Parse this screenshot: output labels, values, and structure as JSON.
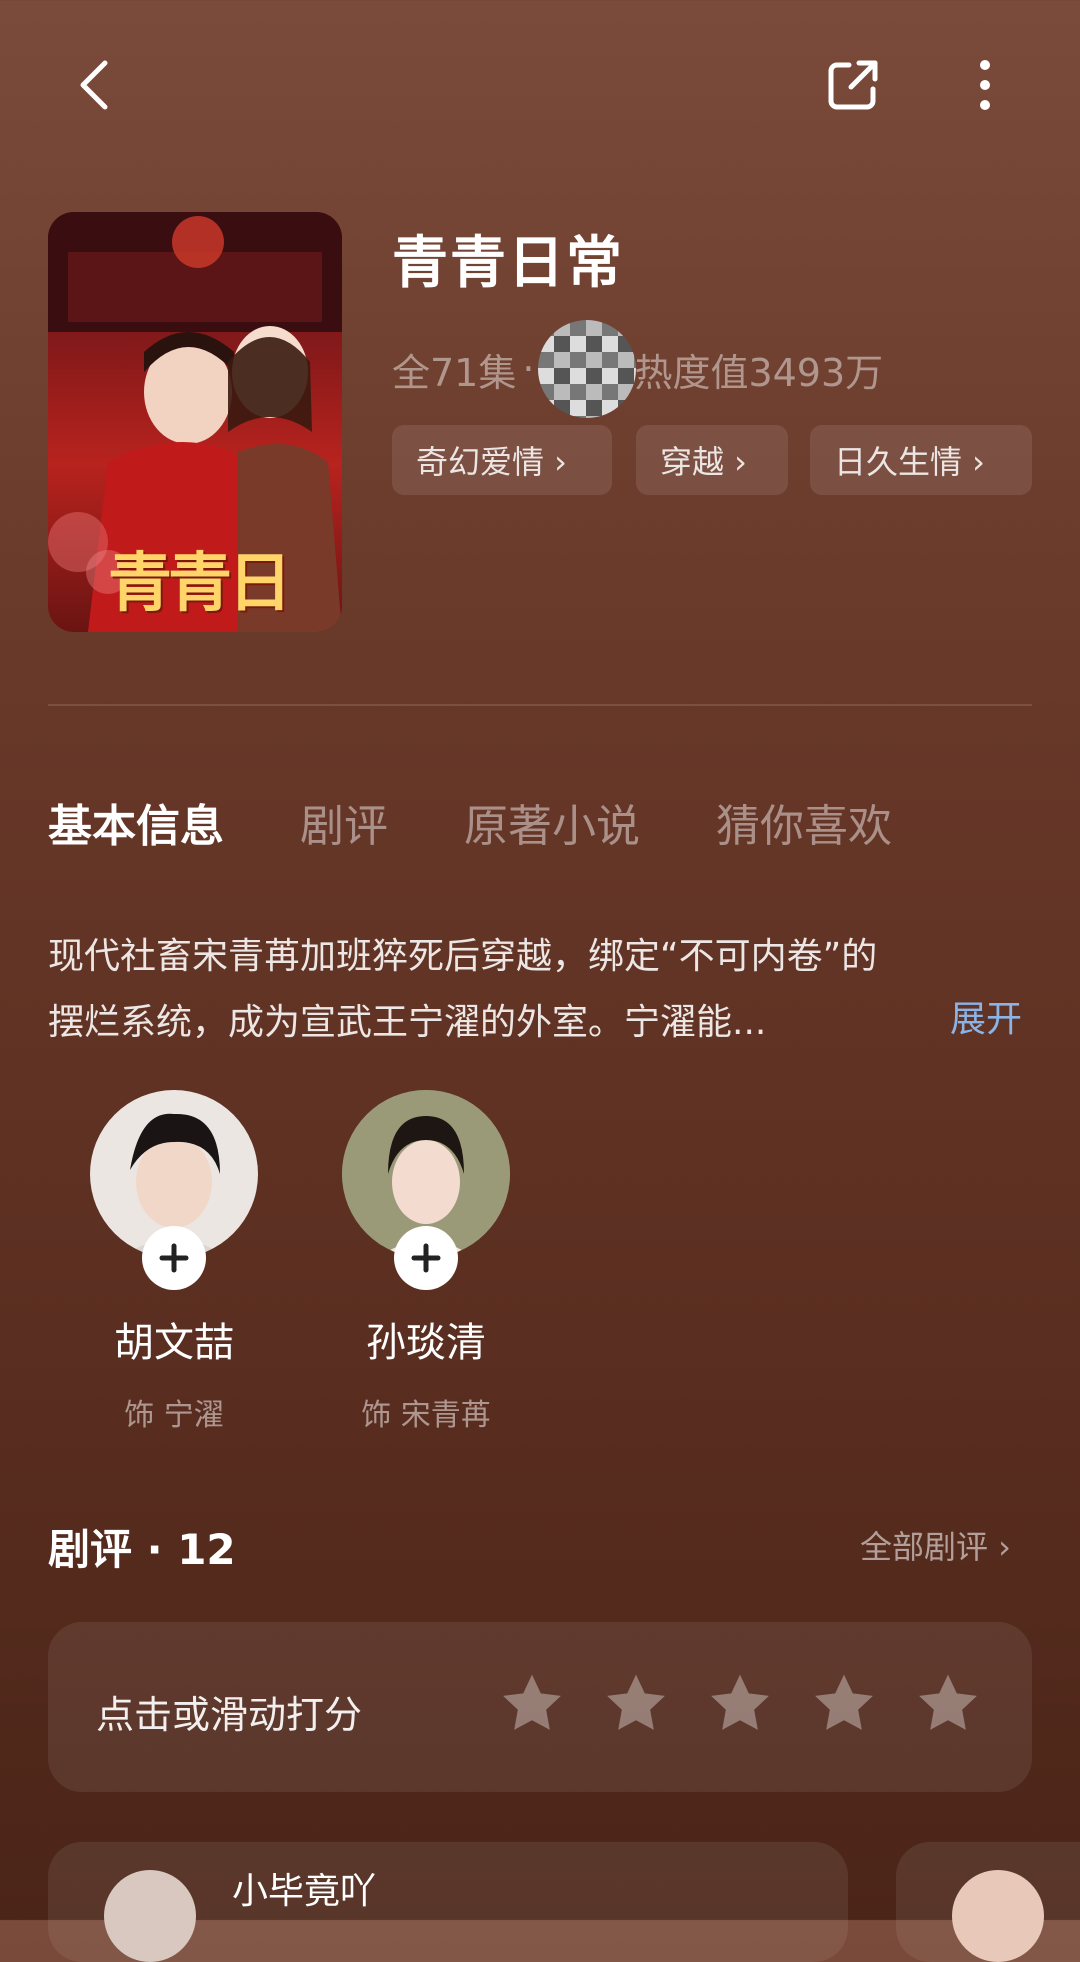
{
  "header": {
    "back_icon": "chevron-left-icon",
    "share_icon": "share-icon",
    "more_icon": "more-vertical-icon"
  },
  "drama": {
    "title": "青青日常",
    "poster_text": "青青日常",
    "episodes": "全71集",
    "separator": "·",
    "heat": "热度值3493万",
    "tags": [
      "奇幻爱情 ›",
      "穿越 ›",
      "日久生情 ›"
    ]
  },
  "tabs": [
    "基本信息",
    "剧评",
    "原著小说",
    "猜你喜欢"
  ],
  "synopsis": {
    "line1": "现代社畜宋青苒加班猝死后穿越，绑定“不可内卷”的",
    "line2": "摆烂系统，成为宣武王宁濯的外室。宁濯能...",
    "expand": "展开"
  },
  "cast": [
    {
      "name": "胡文喆",
      "role": "饰 宁濯"
    },
    {
      "name": "孙琰清",
      "role": "饰 宋青苒"
    }
  ],
  "reviews": {
    "title": "剧评 · 12",
    "all_link": "全部剧评 ›",
    "rating_prompt": "点击或滑动打分",
    "stars": 5,
    "first_review_user": "小毕竟吖"
  },
  "colors": {
    "background_top": "#7a4a3a",
    "background_bottom": "#4b2518",
    "link": "#8ab4e8"
  }
}
